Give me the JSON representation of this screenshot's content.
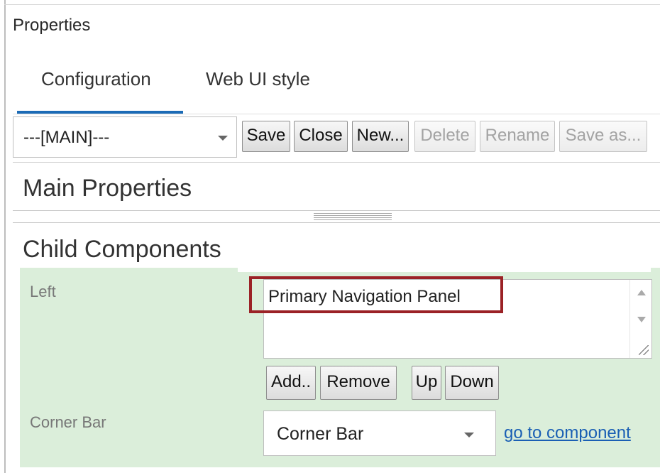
{
  "panel": {
    "title": "Properties"
  },
  "tabs": [
    {
      "label": "Configuration",
      "active": true
    },
    {
      "label": "Web UI style",
      "active": false
    }
  ],
  "toolbar": {
    "config_select_value": "---[MAIN]---",
    "buttons": {
      "save": "Save",
      "close": "Close",
      "new": "New...",
      "delete": "Delete",
      "rename": "Rename",
      "save_as": "Save as..."
    },
    "disabled": [
      "Delete",
      "Rename",
      "Save as..."
    ]
  },
  "sections": {
    "main_properties": "Main Properties",
    "child_components": "Child Components"
  },
  "child_components": {
    "left": {
      "label": "Left",
      "items": [
        "Primary Navigation Panel"
      ],
      "buttons": {
        "add": "Add..",
        "remove": "Remove",
        "up": "Up",
        "down": "Down"
      }
    },
    "corner_bar": {
      "label": "Corner Bar",
      "select_value": "Corner Bar",
      "link": "go to component"
    }
  },
  "colors": {
    "accent": "#1b6bb6",
    "highlight_border": "#9b2226",
    "section_background": "#dbeeda",
    "link": "#1a5fb4"
  }
}
